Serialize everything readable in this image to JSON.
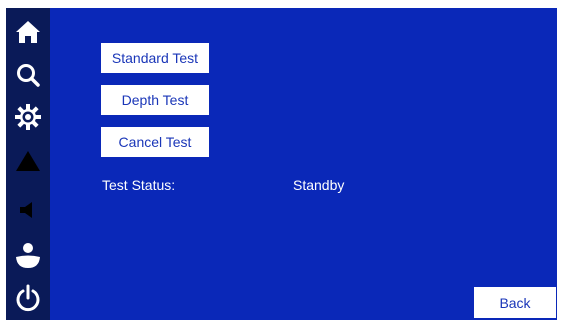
{
  "colors": {
    "panel_background": "#0a28b8",
    "sidebar_background": "#0a1a58",
    "button_background": "#ffffff",
    "button_text": "#1a36b8",
    "label_text": "#ffffff"
  },
  "sidebar": {
    "items": [
      {
        "icon": "home-icon"
      },
      {
        "icon": "search-icon"
      },
      {
        "icon": "gear-icon"
      },
      {
        "icon": "warning-icon"
      },
      {
        "icon": "speaker-icon"
      },
      {
        "icon": "user-icon"
      },
      {
        "icon": "power-icon"
      }
    ]
  },
  "main": {
    "buttons": {
      "standard_test": "Standard Test",
      "depth_test": "Depth Test",
      "cancel_test": "Cancel Test"
    },
    "status": {
      "label": "Test Status:",
      "value": "Standby"
    },
    "back_button": "Back"
  }
}
